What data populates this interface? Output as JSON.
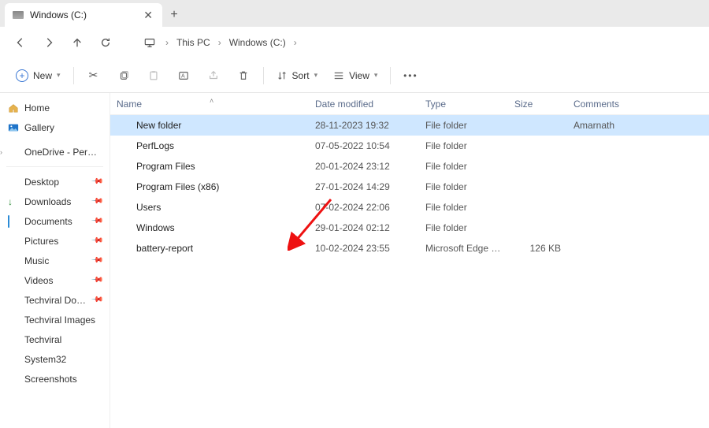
{
  "tab": {
    "title": "Windows (C:)"
  },
  "breadcrumb": [
    "This PC",
    "Windows (C:)"
  ],
  "toolbar": {
    "new": "New",
    "sort": "Sort",
    "view": "View"
  },
  "sidebar": {
    "home": "Home",
    "gallery": "Gallery",
    "onedrive": "OneDrive - Persona",
    "pinned": [
      {
        "name": "desktop",
        "label": "Desktop",
        "icon": "desktop"
      },
      {
        "name": "downloads",
        "label": "Downloads",
        "icon": "download"
      },
      {
        "name": "documents",
        "label": "Documents",
        "icon": "document"
      },
      {
        "name": "pictures",
        "label": "Pictures",
        "icon": "picture"
      },
      {
        "name": "music",
        "label": "Music",
        "icon": "music"
      },
      {
        "name": "videos",
        "label": "Videos",
        "icon": "video"
      },
      {
        "name": "techviral-docum",
        "label": "Techviral Docum",
        "icon": "folder"
      },
      {
        "name": "techviral-images",
        "label": "Techviral Images",
        "icon": "folder"
      },
      {
        "name": "techviral",
        "label": "Techviral",
        "icon": "folder"
      },
      {
        "name": "system32",
        "label": "System32",
        "icon": "folder"
      },
      {
        "name": "screenshots",
        "label": "Screenshots",
        "icon": "folder"
      }
    ]
  },
  "columns": {
    "name": "Name",
    "date": "Date modified",
    "type": "Type",
    "size": "Size",
    "comments": "Comments"
  },
  "rows": [
    {
      "icon": "folder-dark",
      "name": "New folder",
      "date": "28-11-2023 19:32",
      "type": "File folder",
      "size": "",
      "comments": "Amarnath",
      "selected": true
    },
    {
      "icon": "folder",
      "name": "PerfLogs",
      "date": "07-05-2022 10:54",
      "type": "File folder",
      "size": "",
      "comments": ""
    },
    {
      "icon": "folder",
      "name": "Program Files",
      "date": "20-01-2024 23:12",
      "type": "File folder",
      "size": "",
      "comments": ""
    },
    {
      "icon": "folder",
      "name": "Program Files (x86)",
      "date": "27-01-2024 14:29",
      "type": "File folder",
      "size": "",
      "comments": ""
    },
    {
      "icon": "folder",
      "name": "Users",
      "date": "07-02-2024 22:06",
      "type": "File folder",
      "size": "",
      "comments": ""
    },
    {
      "icon": "folder",
      "name": "Windows",
      "date": "29-01-2024 02:12",
      "type": "File folder",
      "size": "",
      "comments": ""
    },
    {
      "icon": "edge",
      "name": "battery-report",
      "date": "10-02-2024 23:55",
      "type": "Microsoft Edge HTM…",
      "size": "126 KB",
      "comments": ""
    }
  ]
}
